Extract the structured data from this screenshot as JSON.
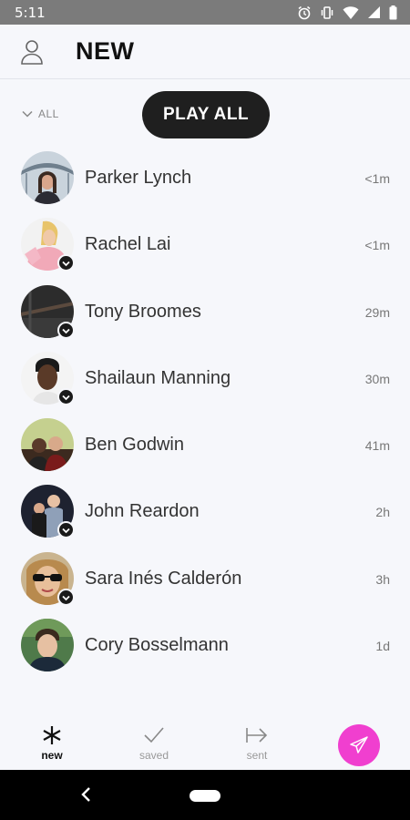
{
  "status_bar": {
    "time": "5:11",
    "icons": [
      "alarm-icon",
      "vibrate-icon",
      "wifi-icon",
      "signal-icon",
      "battery-icon"
    ]
  },
  "header": {
    "title": "NEW",
    "profile_icon": "person-outline-icon"
  },
  "filter": {
    "label": "ALL",
    "icon": "chevron-down-icon"
  },
  "play_all_label": "PLAY ALL",
  "contacts": [
    {
      "name": "Parker Lynch",
      "time": "<1m",
      "checked": false
    },
    {
      "name": "Rachel Lai",
      "time": "<1m",
      "checked": true
    },
    {
      "name": "Tony Broomes",
      "time": "29m",
      "checked": true
    },
    {
      "name": "Shailaun Manning",
      "time": "30m",
      "checked": true
    },
    {
      "name": "Ben Godwin",
      "time": "41m",
      "checked": false
    },
    {
      "name": "John Reardon",
      "time": "2h",
      "checked": true
    },
    {
      "name": "Sara Inés Calderón",
      "time": "3h",
      "checked": true
    },
    {
      "name": "Cory Bosselmann",
      "time": "1d",
      "checked": false
    }
  ],
  "bottom_nav": {
    "new_label": "new",
    "saved_label": "saved",
    "sent_label": "sent",
    "fab_icon": "paper-plane-icon"
  },
  "colors": {
    "accent": "#f03fcf",
    "dark": "#1f1f1f",
    "background": "#f6f7fb",
    "status_bar": "#7b7b7b"
  }
}
